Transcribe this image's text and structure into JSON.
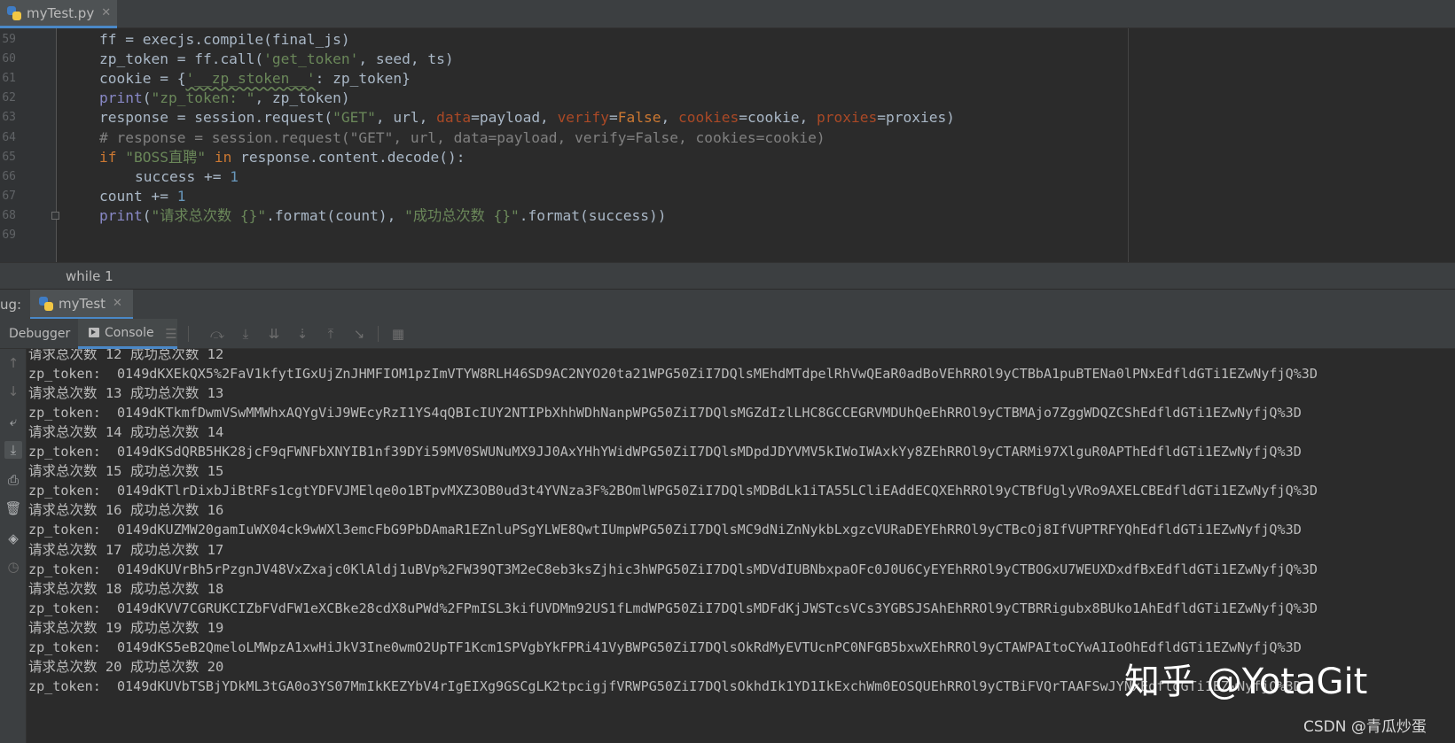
{
  "editor_tab": {
    "filename": "myTest.py",
    "icon": "python-file-icon"
  },
  "editor": {
    "line_numbers": [
      "59",
      "60",
      "61",
      "62",
      "63",
      "64",
      "65",
      "66",
      "67",
      "68",
      "69"
    ],
    "lines": [
      {
        "indent": 1,
        "tokens": [
          {
            "t": "ff = execjs.compile(final_js)",
            "c": ""
          }
        ]
      },
      {
        "indent": 1,
        "tokens": [
          {
            "t": "zp_token = ff.call(",
            "c": ""
          },
          {
            "t": "'get_token'",
            "c": "c-str"
          },
          {
            "t": ", seed, ts)",
            "c": ""
          }
        ]
      },
      {
        "indent": 1,
        "tokens": [
          {
            "t": "cookie = {",
            "c": ""
          },
          {
            "t": "'__zp_stoken__'",
            "c": "c-str squiggle"
          },
          {
            "t": ": zp_token}",
            "c": ""
          }
        ]
      },
      {
        "indent": 1,
        "tokens": [
          {
            "t": "print",
            "c": "c-bi"
          },
          {
            "t": "(",
            "c": ""
          },
          {
            "t": "\"zp_token: \"",
            "c": "c-str"
          },
          {
            "t": ", zp_token)",
            "c": ""
          }
        ]
      },
      {
        "indent": 1,
        "tokens": [
          {
            "t": "response = session.request(",
            "c": ""
          },
          {
            "t": "\"GET\"",
            "c": "c-str"
          },
          {
            "t": ", url, ",
            "c": ""
          },
          {
            "t": "data",
            "c": "c-kwarg"
          },
          {
            "t": "=payload, ",
            "c": ""
          },
          {
            "t": "verify",
            "c": "c-kwarg"
          },
          {
            "t": "=",
            "c": ""
          },
          {
            "t": "False",
            "c": "c-kw"
          },
          {
            "t": ", ",
            "c": ""
          },
          {
            "t": "cookies",
            "c": "c-kwarg"
          },
          {
            "t": "=cookie, ",
            "c": ""
          },
          {
            "t": "proxies",
            "c": "c-kwarg"
          },
          {
            "t": "=proxies)",
            "c": ""
          }
        ]
      },
      {
        "indent": 1,
        "tokens": [
          {
            "t": "# response = session.request(\"GET\", url, data=payload, verify=False, cookies=cookie)",
            "c": "c-com"
          }
        ]
      },
      {
        "indent": 1,
        "tokens": [
          {
            "t": "if ",
            "c": "c-kw"
          },
          {
            "t": "\"BOSS直聘\"",
            "c": "c-str"
          },
          {
            "t": " in ",
            "c": "c-kw"
          },
          {
            "t": "response.content.decode():",
            "c": ""
          }
        ]
      },
      {
        "indent": 2,
        "tokens": [
          {
            "t": "success += ",
            "c": ""
          },
          {
            "t": "1",
            "c": "c-num"
          }
        ]
      },
      {
        "indent": 1,
        "tokens": [
          {
            "t": "count += ",
            "c": ""
          },
          {
            "t": "1",
            "c": "c-num"
          }
        ]
      },
      {
        "indent": 1,
        "tokens": [
          {
            "t": "print",
            "c": "c-bi"
          },
          {
            "t": "(",
            "c": ""
          },
          {
            "t": "\"请求总次数 {}\"",
            "c": "c-str"
          },
          {
            "t": ".format(count), ",
            "c": ""
          },
          {
            "t": "\"成功总次数 {}\"",
            "c": "c-str"
          },
          {
            "t": ".format(success))",
            "c": ""
          }
        ]
      },
      {
        "indent": 1,
        "tokens": []
      }
    ]
  },
  "breadcrumb": "while 1",
  "debug_window": {
    "title": "ug:",
    "run_tab": "myTest",
    "tabs": {
      "debugger": "Debugger",
      "console": "Console"
    }
  },
  "console": {
    "lines": [
      "请求总次数 12 成功总次数 12",
      "zp_token:  0149dKXEkQX5%2FaV1kfytIGxUjZnJHMFIOM1pzImVTYW8RLH46SD9AC2NYO20ta21WPG50ZiI7DQlsMEhdMTdpelRhVwQEaR0adBoVEhRROl9yCTBbA1puBTENa0lPNxEdfldGTi1EZwNyfjQ%3D",
      "请求总次数 13 成功总次数 13",
      "zp_token:  0149dKTkmfDwmVSwMMWhxAQYgViJ9WEcyRzI1YS4qQBIcIUY2NTIPbXhhWDhNanpWPG50ZiI7DQlsMGZdIzlLHC8GCCEGRVMDUhQeEhRROl9yCTBMAjo7ZggWDQZCShEdfldGTi1EZwNyfjQ%3D",
      "请求总次数 14 成功总次数 14",
      "zp_token:  0149dKSdQRB5HK28jcF9qFWNFbXNYIB1nf39DYi59MV0SWUNuMX9JJ0AxYHhYWidWPG50ZiI7DQlsMDpdJDYVMV5kIWoIWAxkYy8ZEhRROl9yCTARMi97XlguR0APThEdfldGTi1EZwNyfjQ%3D",
      "请求总次数 15 成功总次数 15",
      "zp_token:  0149dKTlrDixbJiBtRFs1cgtYDFVJMElqe0o1BTpvMXZ3OB0ud3t4YVNza3F%2BOmlWPG50ZiI7DQlsMDBdLk1iTA55LCliEAddECQXEhRROl9yCTBfUglyVRo9AXELCBEdfldGTi1EZwNyfjQ%3D",
      "请求总次数 16 成功总次数 16",
      "zp_token:  0149dKUZMW20gamIuWX04ck9wWXl3emcFbG9PbDAmaR1EZnluPSgYLWE8QwtIUmpWPG50ZiI7DQlsMC9dNiZnNykbLxgzcVURaDEYEhRROl9yCTBcOj8IfVUPTRFYQhEdfldGTi1EZwNyfjQ%3D",
      "请求总次数 17 成功总次数 17",
      "zp_token:  0149dKUVrBh5rPzgnJV48VxZxajc0KlAldj1uBVp%2FW39QT3M2eC8eb3ksZjhic3hWPG50ZiI7DQlsMDVdIUBNbxpaOFc0J0U6CyEYEhRROl9yCTBOGxU7WEUXDxdfBxEdfldGTi1EZwNyfjQ%3D",
      "请求总次数 18 成功总次数 18",
      "zp_token:  0149dKVV7CGRUKCIZbFVdFW1eXCBke28cdX8uPWd%2FPmISL3kifUVDMm92US1fLmdWPG50ZiI7DQlsMDFdKjJWSTcsVCs3YGBSJSAhEhRROl9yCTBRRigubx8BUko1AhEdfldGTi1EZwNyfjQ%3D",
      "请求总次数 19 成功总次数 19",
      "zp_token:  0149dKS5eB2QmeloLMWpzA1xwHiJkV3Ine0wmO2UpTF1Kcm1SPVgbYkFPRi41VyBWPG50ZiI7DQlsOkRdMyEVTUcnPC0NFGB5bxwXEhRROl9yCTAWPAItoCYwA1IoOhEdfldGTi1EZwNyfjQ%3D",
      "请求总次数 20 成功总次数 20",
      "zp_token:  0149dKUVbTSBjYDkML3tGA0o3YS07MmIkKEZYbV4rIgEIXg9GSCgLK2tpcigjfVRWPG50ZiI7DQlsOkhdIk1YD1IkExchWm0EOSQUEhRROl9yCTBiFVQrTAAFSwJYNxEdfldGTi1EZwNyfjQ%3D"
    ]
  },
  "watermark": "知乎 @YotaGit",
  "credit": "CSDN @青瓜炒蛋"
}
